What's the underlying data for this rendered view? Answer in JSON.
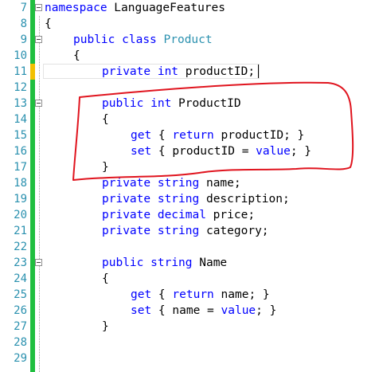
{
  "editor": {
    "accent_change_color": "#1fbf3f",
    "unsaved_change_color": "#f2c000",
    "keyword_color": "#0000ff",
    "type_color": "#2b91af",
    "lines": [
      {
        "num": "7",
        "t": [
          [
            "kw",
            "namespace"
          ],
          [
            "",
            " LanguageFeatures"
          ]
        ],
        "indent": 0,
        "fold": true
      },
      {
        "num": "8",
        "t": [
          [
            "",
            "{"
          ]
        ],
        "indent": 0
      },
      {
        "num": "9",
        "t": [
          [
            "kw",
            "public"
          ],
          [
            "",
            " "
          ],
          [
            "kw",
            "class"
          ],
          [
            "",
            " "
          ],
          [
            "ty",
            "Product"
          ]
        ],
        "indent": 1,
        "fold": true
      },
      {
        "num": "10",
        "t": [
          [
            "",
            "{"
          ]
        ],
        "indent": 1
      },
      {
        "num": "11",
        "t": [
          [
            "kw",
            "private"
          ],
          [
            "",
            " "
          ],
          [
            "kw",
            "int"
          ],
          [
            "",
            " productID;"
          ]
        ],
        "indent": 2
      },
      {
        "num": "12",
        "t": [],
        "indent": 0
      },
      {
        "num": "13",
        "t": [
          [
            "kw",
            "public"
          ],
          [
            "",
            " "
          ],
          [
            "kw",
            "int"
          ],
          [
            "",
            " ProductID"
          ]
        ],
        "indent": 2,
        "fold": true
      },
      {
        "num": "14",
        "t": [
          [
            "",
            "{"
          ]
        ],
        "indent": 2
      },
      {
        "num": "15",
        "t": [
          [
            "kw",
            "get"
          ],
          [
            "",
            " { "
          ],
          [
            "kw",
            "return"
          ],
          [
            "",
            " productID; }"
          ]
        ],
        "indent": 3
      },
      {
        "num": "16",
        "t": [
          [
            "kw",
            "set"
          ],
          [
            "",
            " { productID = "
          ],
          [
            "kw",
            "value"
          ],
          [
            "",
            "; }"
          ]
        ],
        "indent": 3
      },
      {
        "num": "17",
        "t": [
          [
            "",
            "}"
          ]
        ],
        "indent": 2
      },
      {
        "num": "18",
        "t": [
          [
            "kw",
            "private"
          ],
          [
            "",
            " "
          ],
          [
            "kw",
            "string"
          ],
          [
            "",
            " name;"
          ]
        ],
        "indent": 2
      },
      {
        "num": "19",
        "t": [
          [
            "kw",
            "private"
          ],
          [
            "",
            " "
          ],
          [
            "kw",
            "string"
          ],
          [
            "",
            " description;"
          ]
        ],
        "indent": 2
      },
      {
        "num": "20",
        "t": [
          [
            "kw",
            "private"
          ],
          [
            "",
            " "
          ],
          [
            "kw",
            "decimal"
          ],
          [
            "",
            " price;"
          ]
        ],
        "indent": 2
      },
      {
        "num": "21",
        "t": [
          [
            "kw",
            "private"
          ],
          [
            "",
            " "
          ],
          [
            "kw",
            "string"
          ],
          [
            "",
            " category;"
          ]
        ],
        "indent": 2
      },
      {
        "num": "22",
        "t": [],
        "indent": 0
      },
      {
        "num": "23",
        "t": [
          [
            "kw",
            "public"
          ],
          [
            "",
            " "
          ],
          [
            "kw",
            "string"
          ],
          [
            "",
            " Name"
          ]
        ],
        "indent": 2,
        "fold": true
      },
      {
        "num": "24",
        "t": [
          [
            "",
            "{"
          ]
        ],
        "indent": 2
      },
      {
        "num": "25",
        "t": [
          [
            "kw",
            "get"
          ],
          [
            "",
            " { "
          ],
          [
            "kw",
            "return"
          ],
          [
            "",
            " name; }"
          ]
        ],
        "indent": 3
      },
      {
        "num": "26",
        "t": [
          [
            "kw",
            "set"
          ],
          [
            "",
            " { name = "
          ],
          [
            "kw",
            "value"
          ],
          [
            "",
            "; }"
          ]
        ],
        "indent": 3
      },
      {
        "num": "27",
        "t": [
          [
            "",
            "}"
          ]
        ],
        "indent": 2
      },
      {
        "num": "28",
        "t": [],
        "indent": 0
      },
      {
        "num": "29",
        "t": [],
        "indent": 0
      }
    ]
  },
  "annotation": {
    "color": "#e0141e"
  }
}
